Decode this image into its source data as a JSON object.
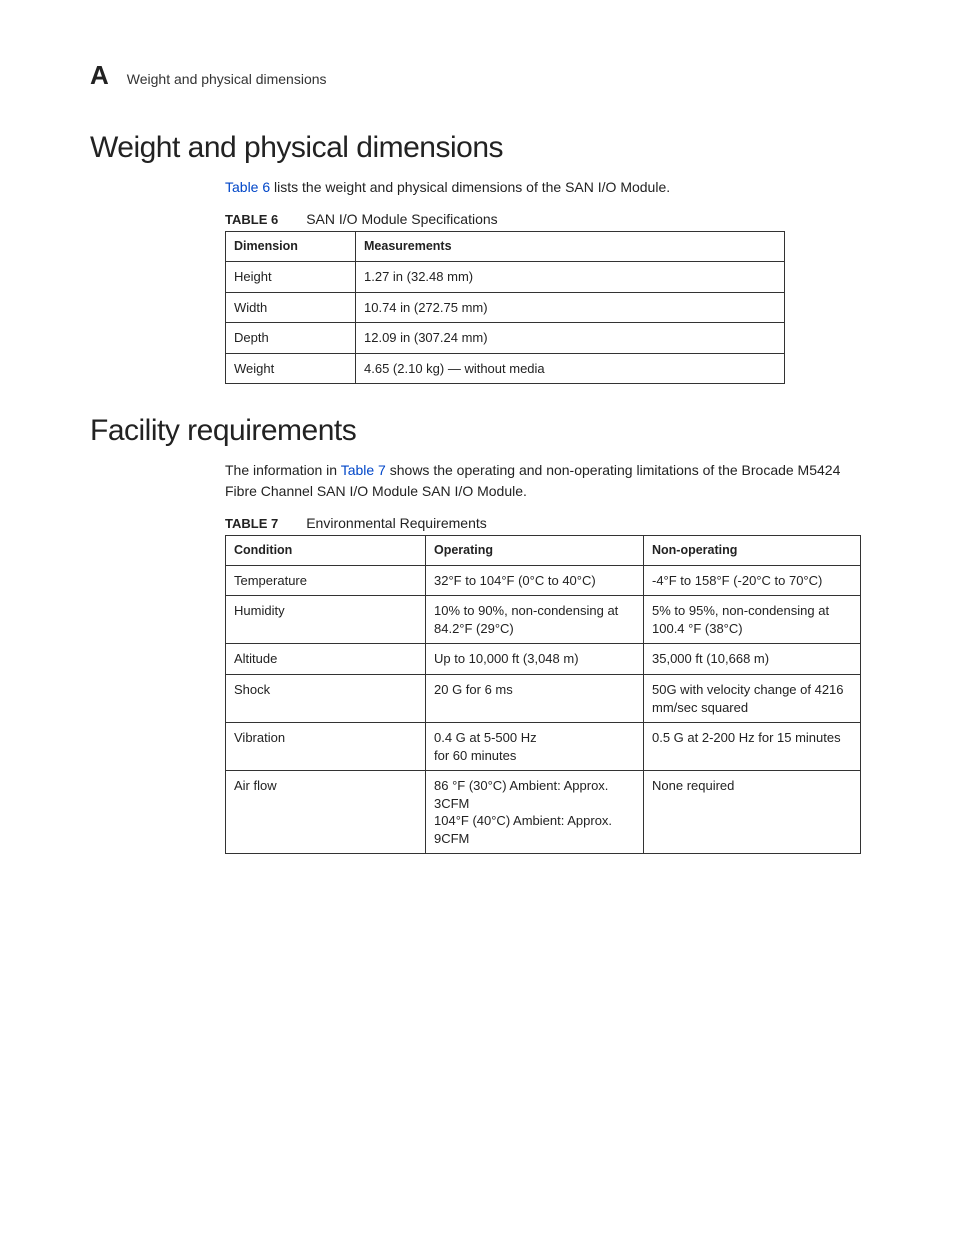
{
  "header": {
    "appendix_letter": "A",
    "running_title": "Weight and physical dimensions"
  },
  "sections": {
    "weight": {
      "heading": "Weight and physical dimensions",
      "intro_pre": "",
      "intro_link": "Table 6",
      "intro_post": " lists the weight and physical dimensions of the SAN I/O Module."
    },
    "facility": {
      "heading": "Facility requirements",
      "intro_pre": "The information in ",
      "intro_link": "Table 7",
      "intro_post": " shows the operating and non-operating limitations of the Brocade M5424 Fibre Channel SAN I/O Module  SAN I/O Module."
    }
  },
  "table6": {
    "label": "TABLE 6",
    "title": "SAN I/O Module Specifications",
    "head": {
      "c1": "Dimension",
      "c2": "Measurements"
    },
    "rows": [
      {
        "c1": "Height",
        "c2": "1.27 in (32.48 mm)"
      },
      {
        "c1": "Width",
        "c2": "10.74 in (272.75 mm)"
      },
      {
        "c1": "Depth",
        "c2": "12.09 in (307.24 mm)"
      },
      {
        "c1": "Weight",
        "c2": "4.65 (2.10 kg) — without media"
      }
    ]
  },
  "table7": {
    "label": "TABLE 7",
    "title": "Environmental Requirements",
    "head": {
      "c1": "Condition",
      "c2": "Operating",
      "c3": "Non-operating"
    },
    "rows": [
      {
        "c1": "Temperature",
        "c2": "32°F to 104°F (0°C to 40°C)",
        "c3": "-4°F to 158°F (-20°C to 70°C)"
      },
      {
        "c1": "Humidity",
        "c2": "10% to 90%, non-condensing at 84.2°F (29°C)",
        "c3": "5% to 95%, non-condensing at 100.4 °F (38°C)"
      },
      {
        "c1": "Altitude",
        "c2": "Up to 10,000 ft (3,048 m)",
        "c3": "35,000 ft (10,668 m)"
      },
      {
        "c1": "Shock",
        "c2": "20 G for 6 ms",
        "c3": "50G with velocity change of 4216 mm/sec squared"
      },
      {
        "c1": "Vibration",
        "c2": "0.4 G at 5-500 Hz\nfor 60 minutes",
        "c3": "0.5 G at 2-200 Hz for 15 minutes"
      },
      {
        "c1": "Air flow",
        "c2": "86 °F (30°C) Ambient: Approx. 3CFM\n104°F (40°C) Ambient: Approx. 9CFM",
        "c3": "None required"
      }
    ]
  }
}
